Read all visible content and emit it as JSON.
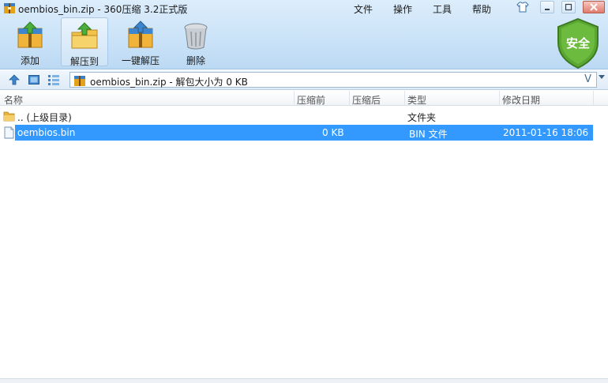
{
  "window": {
    "title": "oembios_bin.zip - 360压缩 3.2正式版",
    "menu": [
      "文件",
      "操作",
      "工具",
      "帮助"
    ]
  },
  "toolbar": {
    "buttons": [
      {
        "label": "添加",
        "icon": "add-archive-icon"
      },
      {
        "label": "解压到",
        "icon": "extract-to-icon",
        "active": true
      },
      {
        "label": "一键解压",
        "icon": "one-click-extract-icon"
      },
      {
        "label": "删除",
        "icon": "trash-icon"
      }
    ],
    "security_badge": "安全"
  },
  "address": {
    "text": "oembios_bin.zip - 解包大小为 0 KB",
    "toggle_label": "V"
  },
  "columns": {
    "name": "名称",
    "compressed": "压缩前",
    "after": "压缩后",
    "type": "类型",
    "modified": "修改日期"
  },
  "files": [
    {
      "name": ".. (上级目录)",
      "compressed": "",
      "after": "",
      "type": "文件夹",
      "modified": "",
      "icon": "folder-icon",
      "selected": false
    },
    {
      "name": "oembios.bin",
      "compressed": "0 KB",
      "after": "",
      "type": "BIN 文件",
      "modified": "2011-01-16 18:06",
      "icon": "file-icon",
      "selected": true
    }
  ],
  "colors": {
    "selection": "#3399ff",
    "toolbar_bg": "#cbe3f8",
    "shield_green": "#5aa832"
  }
}
